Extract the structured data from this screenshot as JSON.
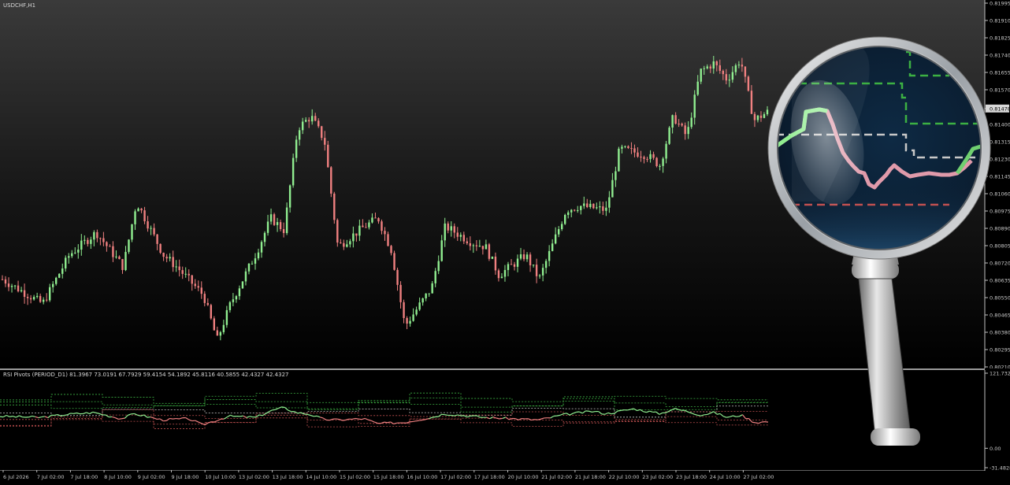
{
  "window": {
    "symbol_label": "USDCHF,H1"
  },
  "indicator": {
    "caption": "RSI Pivots (PERIOD_D1) 81.3967 73.0191 67.7929 59.4154 54.1892 45.8116 40.5855 42.4327 42.4327"
  },
  "price_axis": {
    "labels": [
      "0.81995",
      "0.81910",
      "0.81825",
      "0.81740",
      "0.81655",
      "0.81570",
      "0.81478",
      "0.81400",
      "0.81315",
      "0.81230",
      "0.81145",
      "0.81060",
      "0.80975",
      "0.80890",
      "0.80805",
      "0.80720",
      "0.80635",
      "0.80550",
      "0.80465",
      "0.80380",
      "0.80295",
      "0.80210"
    ],
    "current_price": "0.81478"
  },
  "rsi_axis": {
    "labels": [
      "121.7321",
      "0.00",
      "-31.4828"
    ]
  },
  "time_axis": {
    "labels": [
      "6 Jul 2026",
      "7 Jul 02:00",
      "7 Jul 18:00",
      "8 Jul 10:00",
      "9 Jul 02:00",
      "9 Jul 18:00",
      "10 Jul 10:00",
      "13 Jul 02:00",
      "13 Jul 18:00",
      "14 Jul 10:00",
      "15 Jul 02:00",
      "15 Jul 18:00",
      "16 Jul 10:00",
      "17 Jul 02:00",
      "17 Jul 18:00",
      "20 Jul 10:00",
      "21 Jul 02:00",
      "21 Jul 18:00",
      "22 Jul 10:00",
      "23 Jul 02:00",
      "23 Jul 18:00",
      "24 Jul 10:00",
      "27 Jul 02:00"
    ]
  },
  "colors": {
    "background": "#000000",
    "bull": "#90EE90",
    "bear": "#F08080",
    "pivot_green": "#3cb043",
    "pivot_white": "#c8c8c8",
    "pivot_red": "#c05050",
    "axis": "#c0c0c0"
  },
  "chart_data": [
    {
      "type": "candlestick",
      "title": "USDCHF,H1",
      "ylim": [
        0.8021,
        0.81995
      ],
      "x_ticks": [
        "6 Jul 2026",
        "7 Jul 02:00",
        "7 Jul 18:00",
        "8 Jul 10:00",
        "9 Jul 02:00",
        "9 Jul 18:00",
        "10 Jul 10:00",
        "13 Jul 02:00",
        "13 Jul 18:00",
        "14 Jul 10:00",
        "15 Jul 02:00",
        "15 Jul 18:00",
        "16 Jul 10:00",
        "17 Jul 02:00",
        "17 Jul 18:00",
        "20 Jul 10:00",
        "21 Jul 02:00",
        "21 Jul 18:00",
        "22 Jul 10:00",
        "23 Jul 02:00",
        "23 Jul 18:00",
        "24 Jul 10:00",
        "27 Jul 02:00"
      ],
      "close_path": [
        [
          0,
          0.8064
        ],
        [
          6,
          0.8052
        ],
        [
          10,
          0.8076
        ],
        [
          14,
          0.8087
        ],
        [
          18,
          0.807
        ],
        [
          20,
          0.8102
        ],
        [
          24,
          0.8076
        ],
        [
          26,
          0.807
        ],
        [
          30,
          0.8056
        ],
        [
          32,
          0.8034
        ],
        [
          34,
          0.8052
        ],
        [
          38,
          0.8078
        ],
        [
          40,
          0.8094
        ],
        [
          42,
          0.8088
        ],
        [
          44,
          0.8138
        ],
        [
          46,
          0.8144
        ],
        [
          48,
          0.8132
        ],
        [
          50,
          0.808
        ],
        [
          54,
          0.809
        ],
        [
          56,
          0.8094
        ],
        [
          58,
          0.8078
        ],
        [
          60,
          0.8041
        ],
        [
          64,
          0.806
        ],
        [
          66,
          0.809
        ],
        [
          70,
          0.8082
        ],
        [
          72,
          0.808
        ],
        [
          74,
          0.8066
        ],
        [
          78,
          0.8076
        ],
        [
          80,
          0.8064
        ],
        [
          84,
          0.8098
        ],
        [
          86,
          0.81
        ],
        [
          90,
          0.8098
        ],
        [
          92,
          0.8128
        ],
        [
          96,
          0.8125
        ],
        [
          98,
          0.812
        ],
        [
          100,
          0.8144
        ],
        [
          102,
          0.8134
        ],
        [
          104,
          0.8166
        ],
        [
          106,
          0.817
        ],
        [
          108,
          0.8162
        ],
        [
          110,
          0.8172
        ],
        [
          112,
          0.8142
        ],
        [
          114,
          0.8146
        ]
      ],
      "current_price": 0.81478
    },
    {
      "type": "line",
      "title": "RSI Pivots (PERIOD_D1)",
      "ylim": [
        -31.4828,
        121.7321
      ],
      "pivot_levels": [
        81.3967,
        73.0191,
        67.7929,
        59.4154,
        54.1892,
        45.8116,
        40.5855
      ],
      "last_values": [
        42.4327,
        42.4327
      ],
      "rsi_path": [
        [
          0,
          52
        ],
        [
          6,
          50
        ],
        [
          10,
          55
        ],
        [
          14,
          58
        ],
        [
          18,
          48
        ],
        [
          20,
          56
        ],
        [
          24,
          46
        ],
        [
          28,
          48
        ],
        [
          30,
          38
        ],
        [
          34,
          52
        ],
        [
          38,
          50
        ],
        [
          40,
          60
        ],
        [
          42,
          66
        ],
        [
          44,
          58
        ],
        [
          46,
          55
        ],
        [
          48,
          47
        ],
        [
          50,
          46
        ],
        [
          54,
          48
        ],
        [
          56,
          40
        ],
        [
          60,
          42
        ],
        [
          64,
          50
        ],
        [
          66,
          56
        ],
        [
          70,
          52
        ],
        [
          72,
          50
        ],
        [
          76,
          48
        ],
        [
          80,
          46
        ],
        [
          84,
          55
        ],
        [
          88,
          60
        ],
        [
          90,
          56
        ],
        [
          94,
          64
        ],
        [
          98,
          56
        ],
        [
          100,
          64
        ],
        [
          102,
          60
        ],
        [
          104,
          54
        ],
        [
          106,
          58
        ],
        [
          108,
          50
        ],
        [
          110,
          54
        ],
        [
          112,
          42
        ],
        [
          114,
          43
        ]
      ]
    }
  ]
}
